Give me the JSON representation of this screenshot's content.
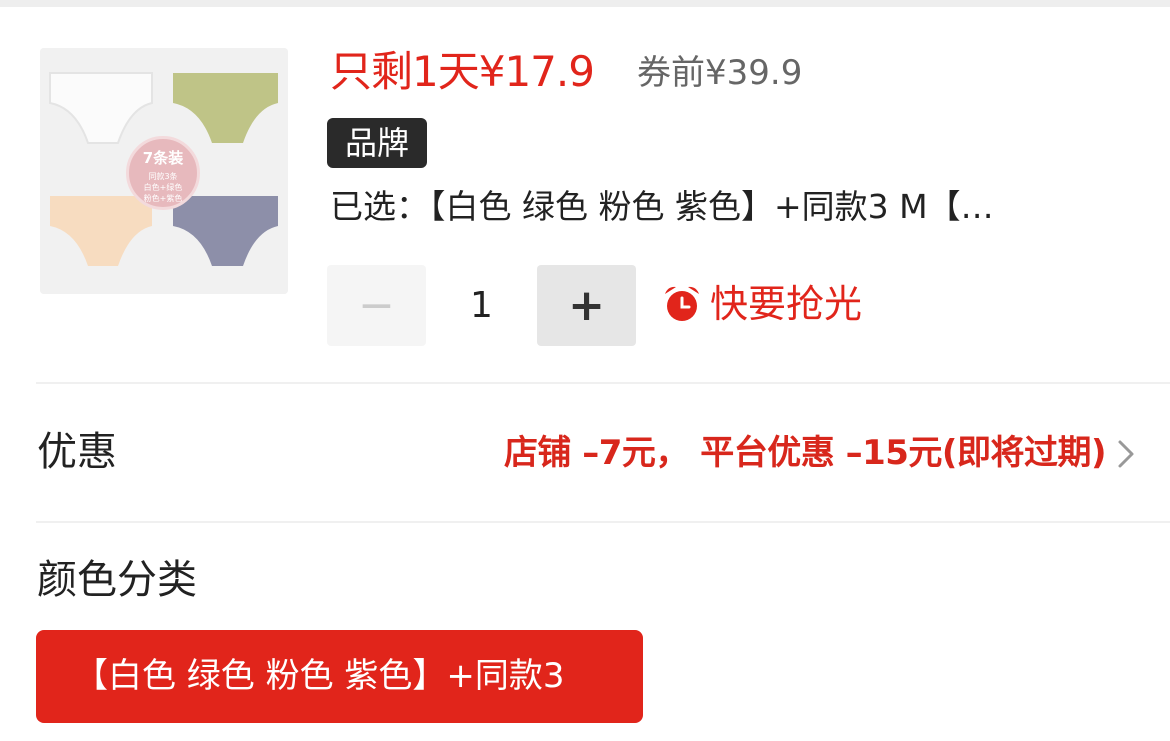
{
  "product": {
    "image": {
      "badge_main": "7条装",
      "badge_lines": [
        "同款3条",
        "白色+绿色",
        "粉色+紫色"
      ]
    },
    "price_now": "只剩1天¥17.9",
    "price_before": "券前¥39.9",
    "brand_tag": "品牌",
    "selected": "已选：【白色 绿色 粉色 紫色】+同款3 M【…",
    "quantity": {
      "minus_label": "−",
      "value": "1",
      "plus_label": "+"
    },
    "stock_hint": "快要抢光"
  },
  "promo": {
    "label": "优惠",
    "value": "店铺 –7元， 平台优惠 –15元(即将过期)"
  },
  "color_section": {
    "title": "颜色分类",
    "selected_option": "【白色 绿色 粉色 紫色】+同款3"
  },
  "colors": {
    "accent": "#e1251b",
    "brand_tag_bg": "#2a2a2a"
  },
  "icons": {
    "stock_hint": "alarm-clock-icon",
    "promo_chevron": "chevron-right-icon"
  }
}
